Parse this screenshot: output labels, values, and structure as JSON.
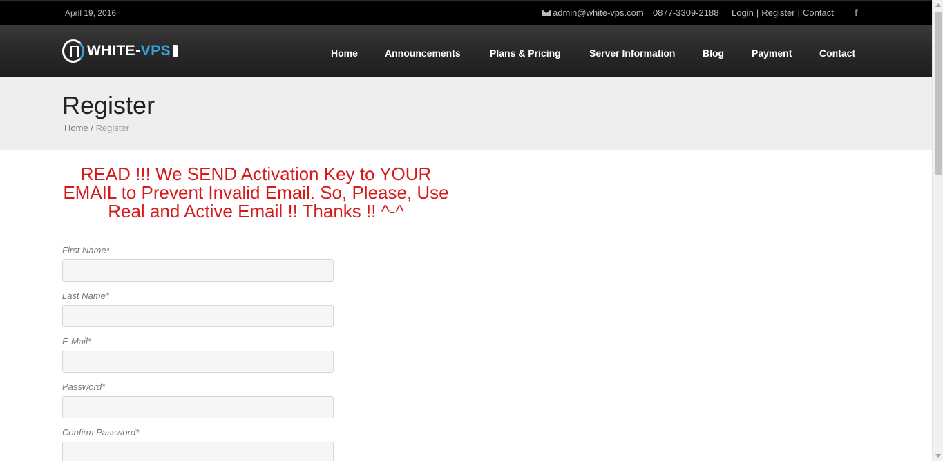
{
  "topbar": {
    "date": "April 19, 2016",
    "email": "admin@white-vps.com",
    "phone": "0877-3309-2188",
    "links": [
      "Login",
      "Register",
      "Contact"
    ],
    "separator": "|",
    "facebook_icon": "f"
  },
  "header": {
    "logo_text": "WHITE-",
    "logo_text_accent": "VPS",
    "nav": [
      "Home",
      "Announcements",
      "Plans & Pricing",
      "Server Information",
      "Blog",
      "Payment",
      "Contact"
    ]
  },
  "page": {
    "title": "Register",
    "breadcrumb": {
      "home": "Home",
      "separator": "/",
      "current": "Register"
    }
  },
  "notice": "READ !!! We SEND Activation Key to YOUR EMAIL to Prevent Invalid Email. So, Please, Use Real and Active Email !! Thanks !! ^-^",
  "form": {
    "fields": [
      {
        "label": "First Name*",
        "value": ""
      },
      {
        "label": "Last Name*",
        "value": ""
      },
      {
        "label": "E-Mail*",
        "value": ""
      },
      {
        "label": "Password*",
        "value": ""
      },
      {
        "label": "Confirm Password*",
        "value": ""
      }
    ]
  },
  "colors": {
    "notice": "#d61a1a",
    "logo_accent": "#3aa0d8",
    "topbar_bg": "#000000"
  }
}
